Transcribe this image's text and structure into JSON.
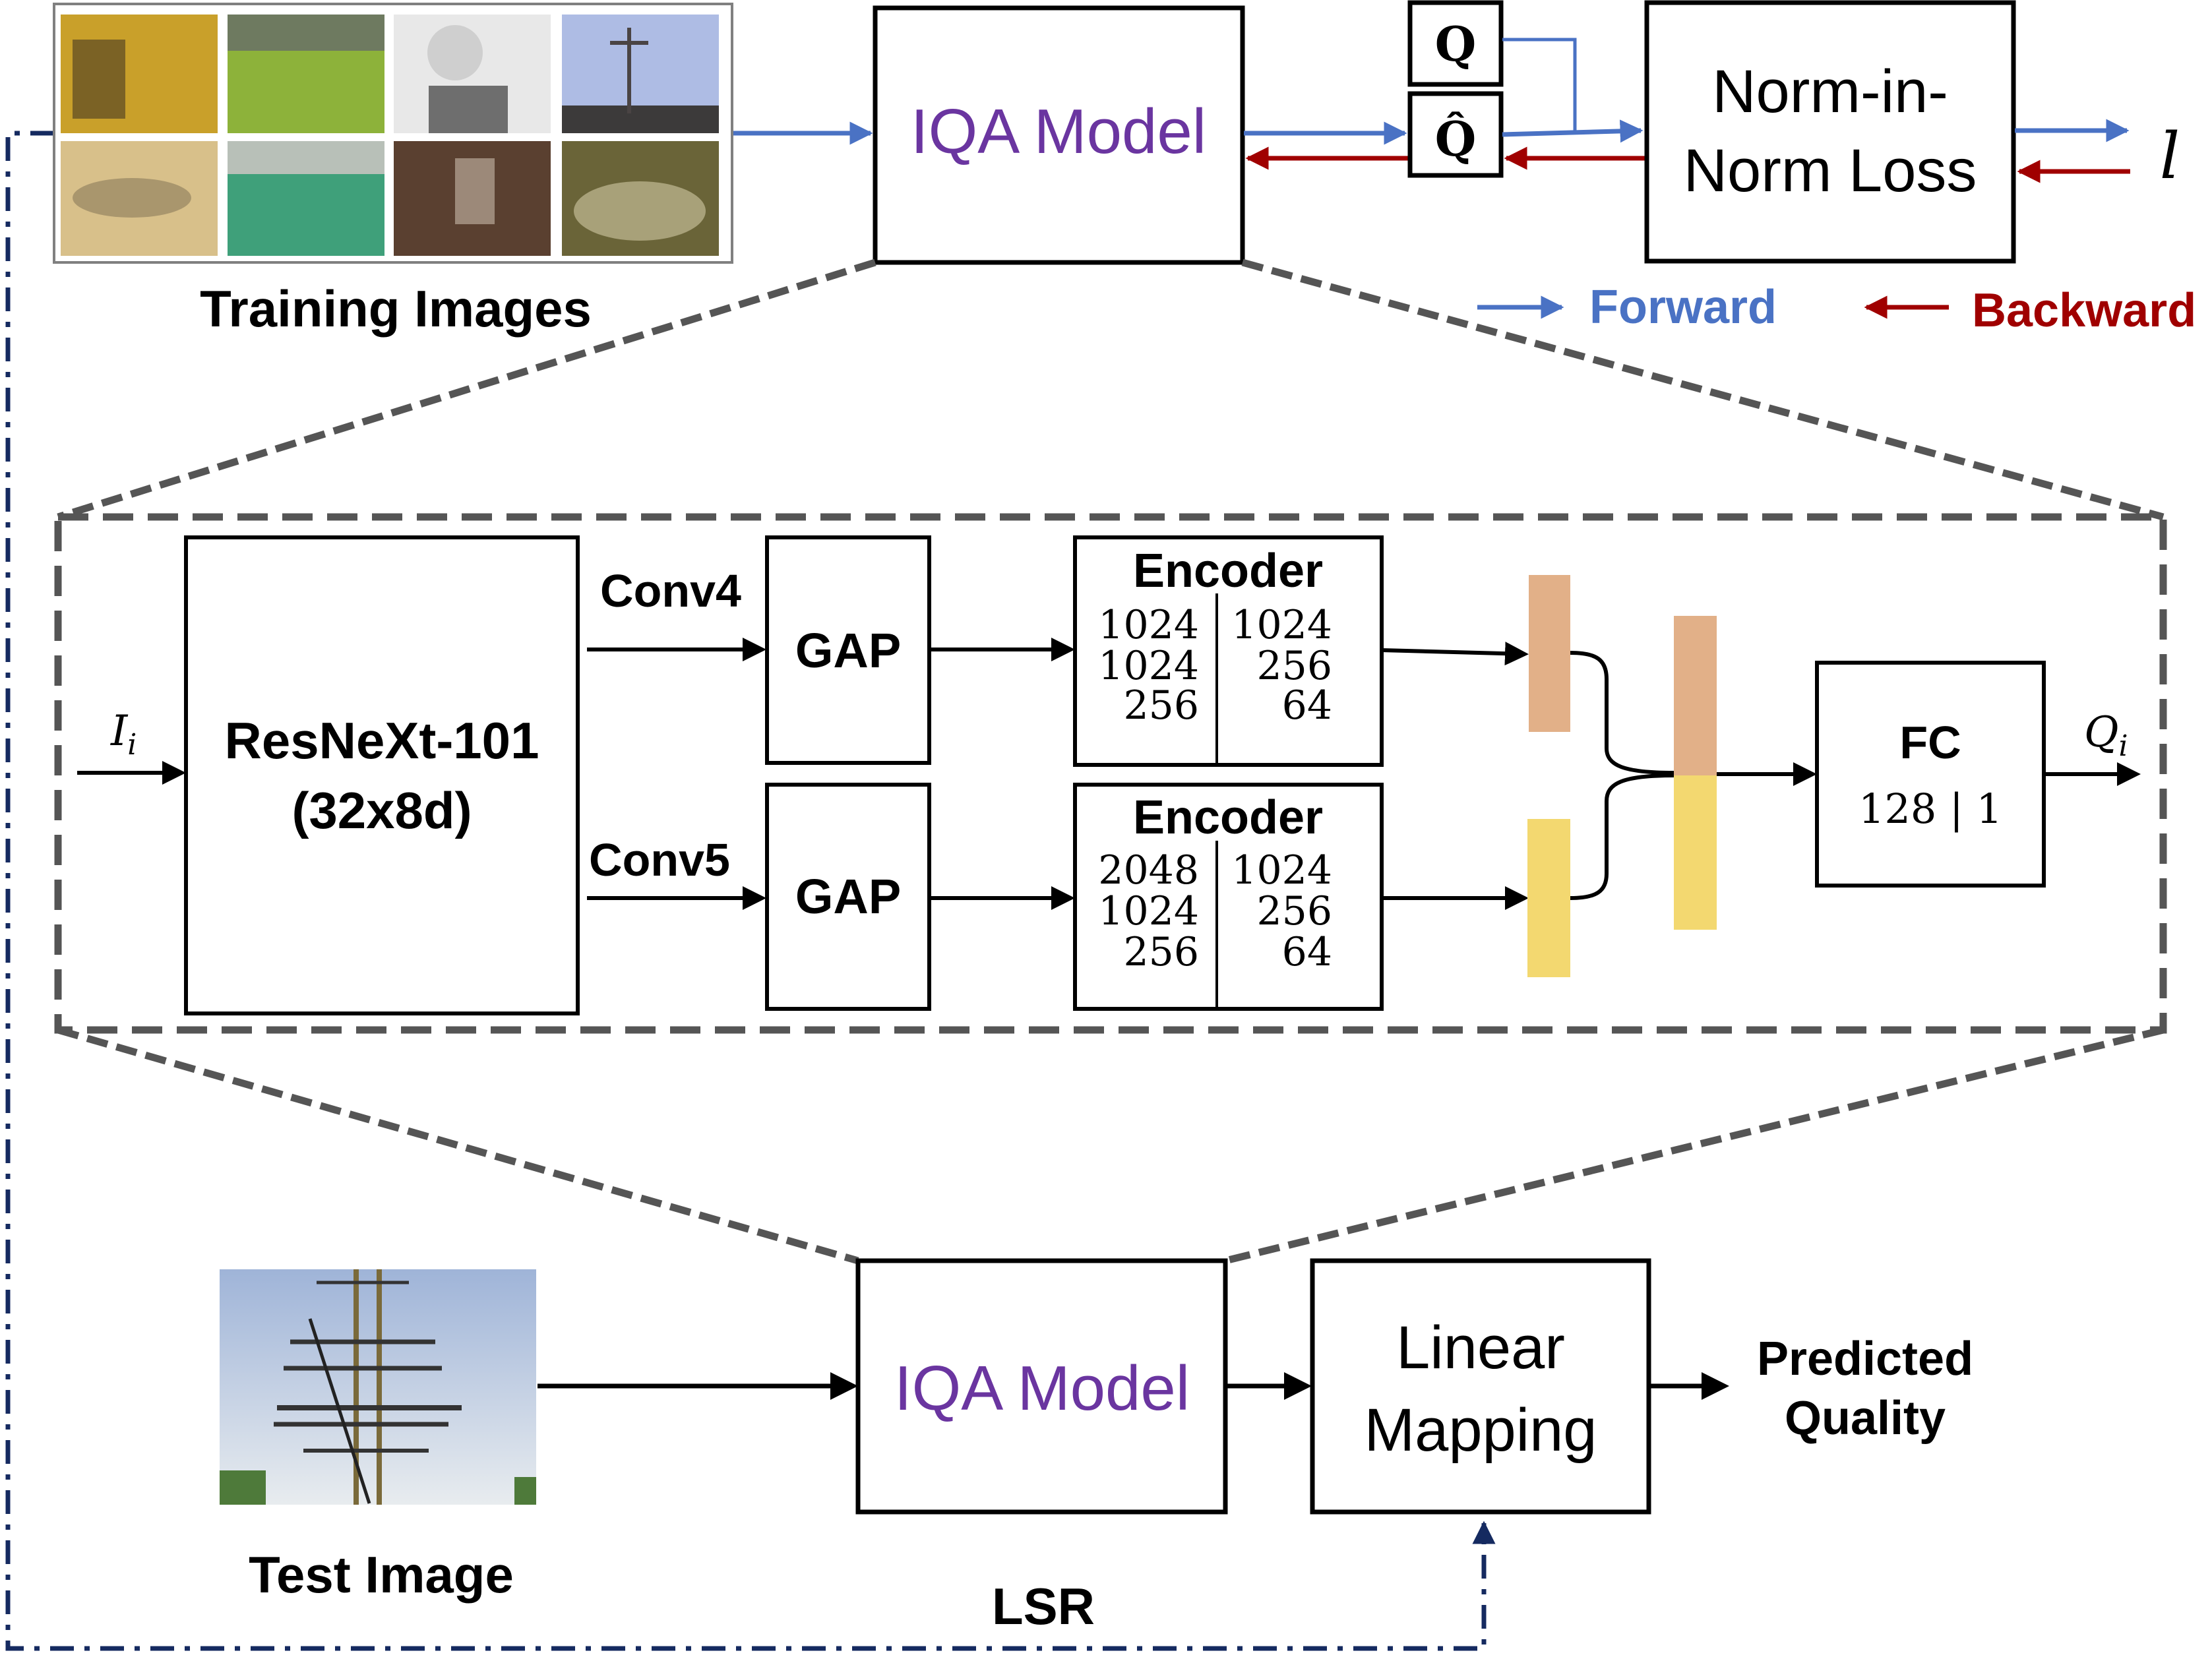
{
  "colors": {
    "forward": "#4A72C4",
    "backward": "#A00000",
    "model_text": "#6A35A0",
    "dashed_zoom": "#555555",
    "lsr_line": "#152A60",
    "feature_conv4": "#E2B088",
    "feature_conv5": "#F3D870"
  },
  "top": {
    "training_images_label": "Training Images",
    "training_thumbnails": [
      "car-with-person",
      "grass-field",
      "baby-bw",
      "cross-on-hill",
      "leopard",
      "field-hockey",
      "cave-interior",
      "abandoned-car"
    ],
    "iqa_model_label": "IQA Model",
    "q_label": "Q",
    "q_hat_label": "Q̂",
    "loss_label_line1": "Norm-in-",
    "loss_label_line2": "Norm Loss",
    "loss_output": "l",
    "legend_forward": "Forward",
    "legend_backward": "Backward"
  },
  "detail": {
    "input_label": "I",
    "input_sub": "i",
    "backbone_line1": "ResNeXt-101",
    "backbone_line2": "(32x8d)",
    "conv4_label": "Conv4",
    "conv5_label": "Conv5",
    "gap_label": "GAP",
    "encoder1": {
      "title": "Encoder",
      "rows": [
        [
          "1024",
          "1024"
        ],
        [
          "1024",
          "256"
        ],
        [
          "256",
          "64"
        ]
      ]
    },
    "encoder2": {
      "title": "Encoder",
      "rows": [
        [
          "2048",
          "1024"
        ],
        [
          "1024",
          "256"
        ],
        [
          "256",
          "64"
        ]
      ]
    },
    "fc_title": "FC",
    "fc_dims": "128 | 1",
    "output_label": "Q",
    "output_sub": "i"
  },
  "bottom": {
    "test_image_label": "Test Image",
    "iqa_model_label": "IQA Model",
    "linear_line1": "Linear",
    "linear_line2": "Mapping",
    "predicted_line1": "Predicted",
    "predicted_line2": "Quality",
    "lsr_label": "LSR"
  }
}
